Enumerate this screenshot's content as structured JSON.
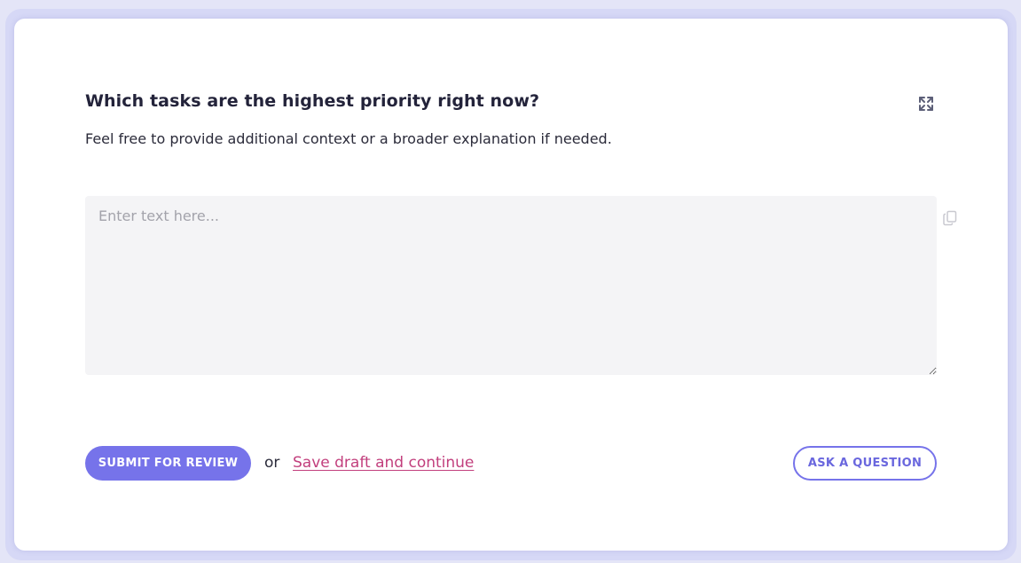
{
  "question": {
    "title": "Which tasks are the highest priority right now?",
    "subtitle": "Feel free to provide additional context or a broader explanation if needed."
  },
  "answer": {
    "value": "",
    "placeholder": "Enter text here..."
  },
  "icons": {
    "expand": "expand-icon",
    "copy": "copy-icon"
  },
  "actions": {
    "submit_label": "SUBMIT FOR REVIEW",
    "or_label": "or",
    "save_draft_label": "Save draft and continue",
    "ask_label": "ASK A QUESTION"
  },
  "colors": {
    "accent": "#7673ea",
    "link": "#c23f7d",
    "frame": "#d6d8f6",
    "input_bg": "#f4f4f6"
  }
}
